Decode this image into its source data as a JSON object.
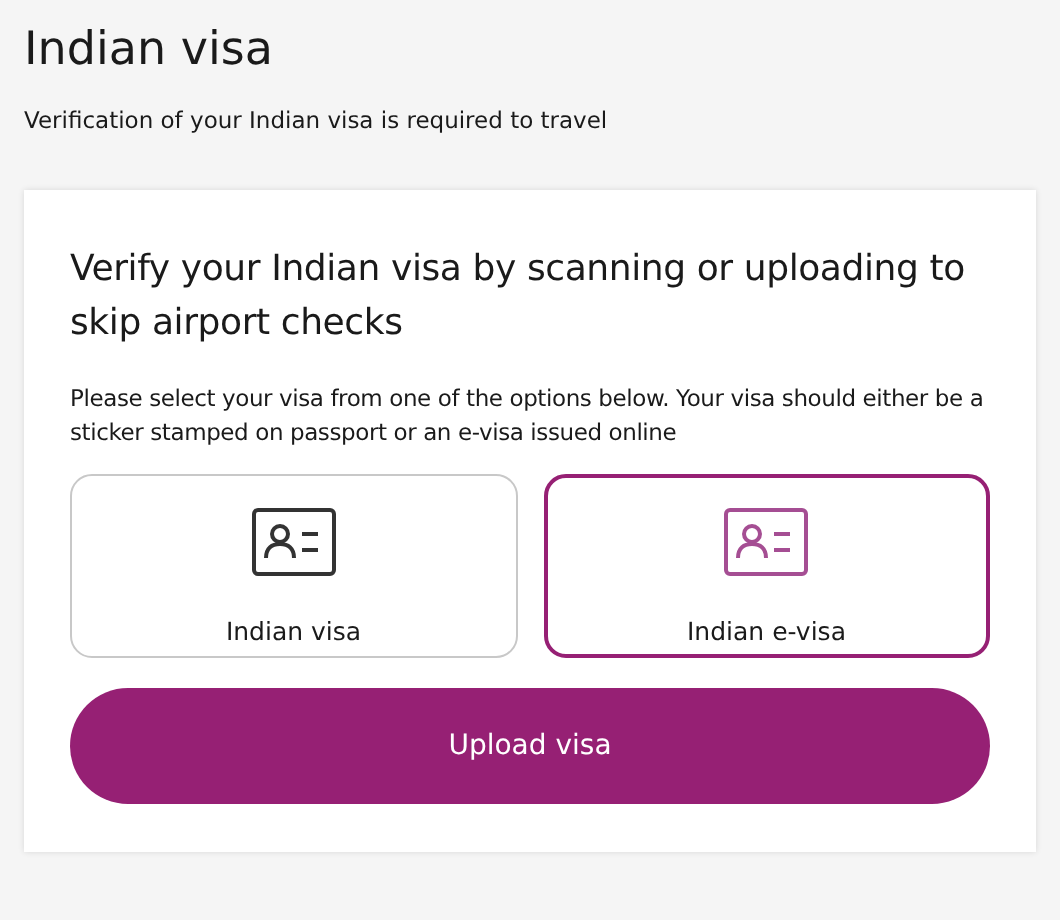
{
  "page": {
    "title": "Indian visa",
    "subtitle": "Verification of your Indian visa is required to travel"
  },
  "card": {
    "heading": "Verify your Indian visa by scanning or uploading to skip airport checks",
    "description": "Please select your visa from one of the options below. Your visa should either be a sticker stamped on passport or an e-visa issued online",
    "options": [
      {
        "label": "Indian visa",
        "selected": false
      },
      {
        "label": "Indian e-visa",
        "selected": true
      }
    ],
    "button": "Upload visa"
  }
}
